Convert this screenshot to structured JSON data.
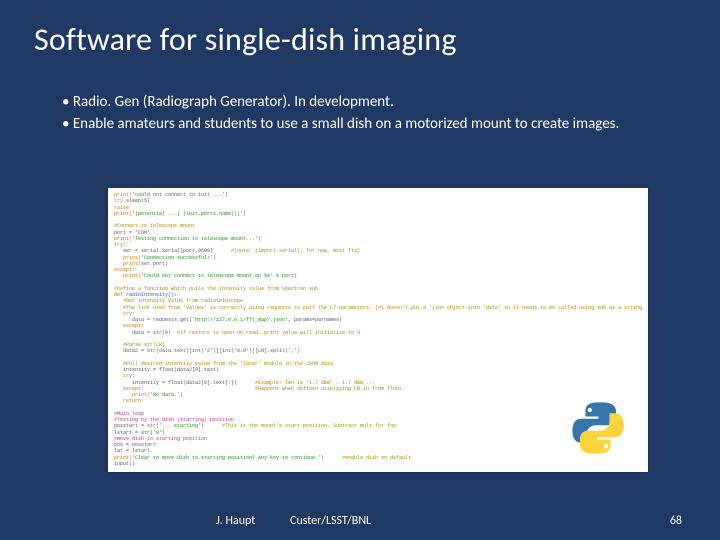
{
  "title": "Software for single-dish imaging",
  "bullets": [
    "• Radio. Gen (Radiograph Generator). In development.",
    "• Enable amateurs and students to use a small dish on a motorized mount to create images."
  ],
  "code": {
    "l1a": "print(",
    "l1b": "'could not connect to init ...'",
    "l1c": ")",
    "l2a": "try",
    "l2b": ".sleep(5)",
    "l3": "raise",
    "l4a": "print(",
    "l4b": "'(potential ...) (init.ports.name())'",
    "l4c": ")",
    "l5a": "#Connect to telescope mount",
    "l6": "port = 'COM'",
    "l7a": "print(",
    "l7b": "'Testing connection to telescope mount...'",
    "l7c": ")",
    "l8": "try:",
    "l9a": "   ser = serial.Serial(port,9600)",
    "l9b": "      #(note: (import serial); for now, most fix)",
    "l10a": "   print(",
    "l10b": "'Connection successful!'",
    "l10c": ")",
    "l11a": "   print(",
    "l11b": "ser.port",
    "l11c": ")",
    "l12": "except:",
    "l13a": "   print(",
    "l13b": "'Could not connect to telescope mount on %s' % port",
    "l13c": ")",
    "l14a": "#Define a function which pulls the intensity value from Spectran sub",
    "l15a": "def ",
    "l15b": "radioIntensity",
    "l15c": "():",
    "l16a": "   #Get intensity value from radiotelescope",
    "l17a": "   #The link used from 'values' is correctly using requests to pull the LT parameters. (#1 doesn't put a 'json object into 'data' so it needs to be called using sub as a string",
    "l18": "   try:",
    "l19a": "      data = requests.get(",
    "l19b": "'http://127.0.0.1/fft_map?.json'",
    "l19c": ", params=parnames)",
    "l20": "   except:",
    "l21a": "      data = str(",
    "l21b": "0",
    "l21c": ")  ",
    "l21d": "#if restore is open on read, print value will initialize to 0",
    "l22a": "   #Parse str(LR)",
    "l23a": "   data2 = str(data.text)[int(",
    "l23b": "'2'",
    "l23c": ")][int(",
    "l23d": "'0.9'",
    "l23e": ")][LR].split(',')",
    "l24a": "   #Pull desired intensity value from the 'later' module in the JSON data",
    "l25": "   intensity = float(data2[0].text)",
    "l26": "   try:",
    "l27a": "      intensity = float(data2[0].text[:])",
    "l27b": "      #Example: len is '1.7 dBm' → 1.7 dBm ...",
    "l28a": "   except:                                     ",
    "l28b": "#Happens when defined displaying LR in from float.",
    "l29a": "      print(",
    "l29b": "'No data.'",
    "l29c": ")",
    "l30": "   return",
    "l31a": "#Main loop",
    "l32a": "#Testing by the dish (starting) position",
    "l33a": "posstart = str(",
    "l33b": "'... starting'",
    "l33c": ")",
    "l33d": "      #This is the mount's start position. Subtract mult for fov.",
    "l34a": "lstart = str(",
    "l34b": "'0'",
    "l34c": ")",
    "l35a": "#move dish to starting position",
    "l36": "pos = posstart",
    "l37": "lat = lstart",
    "l38a": "print(",
    "l38b": "'Clear to move dish to starting position? Any key to continue.'",
    "l38c": ")",
    "l38d": "      #enable dish on default",
    "l39": "input()"
  },
  "logo_name": "python-logo",
  "footer": {
    "author": "J. Haupt",
    "affiliation": "Custer/LSST/BNL",
    "page": "68"
  }
}
